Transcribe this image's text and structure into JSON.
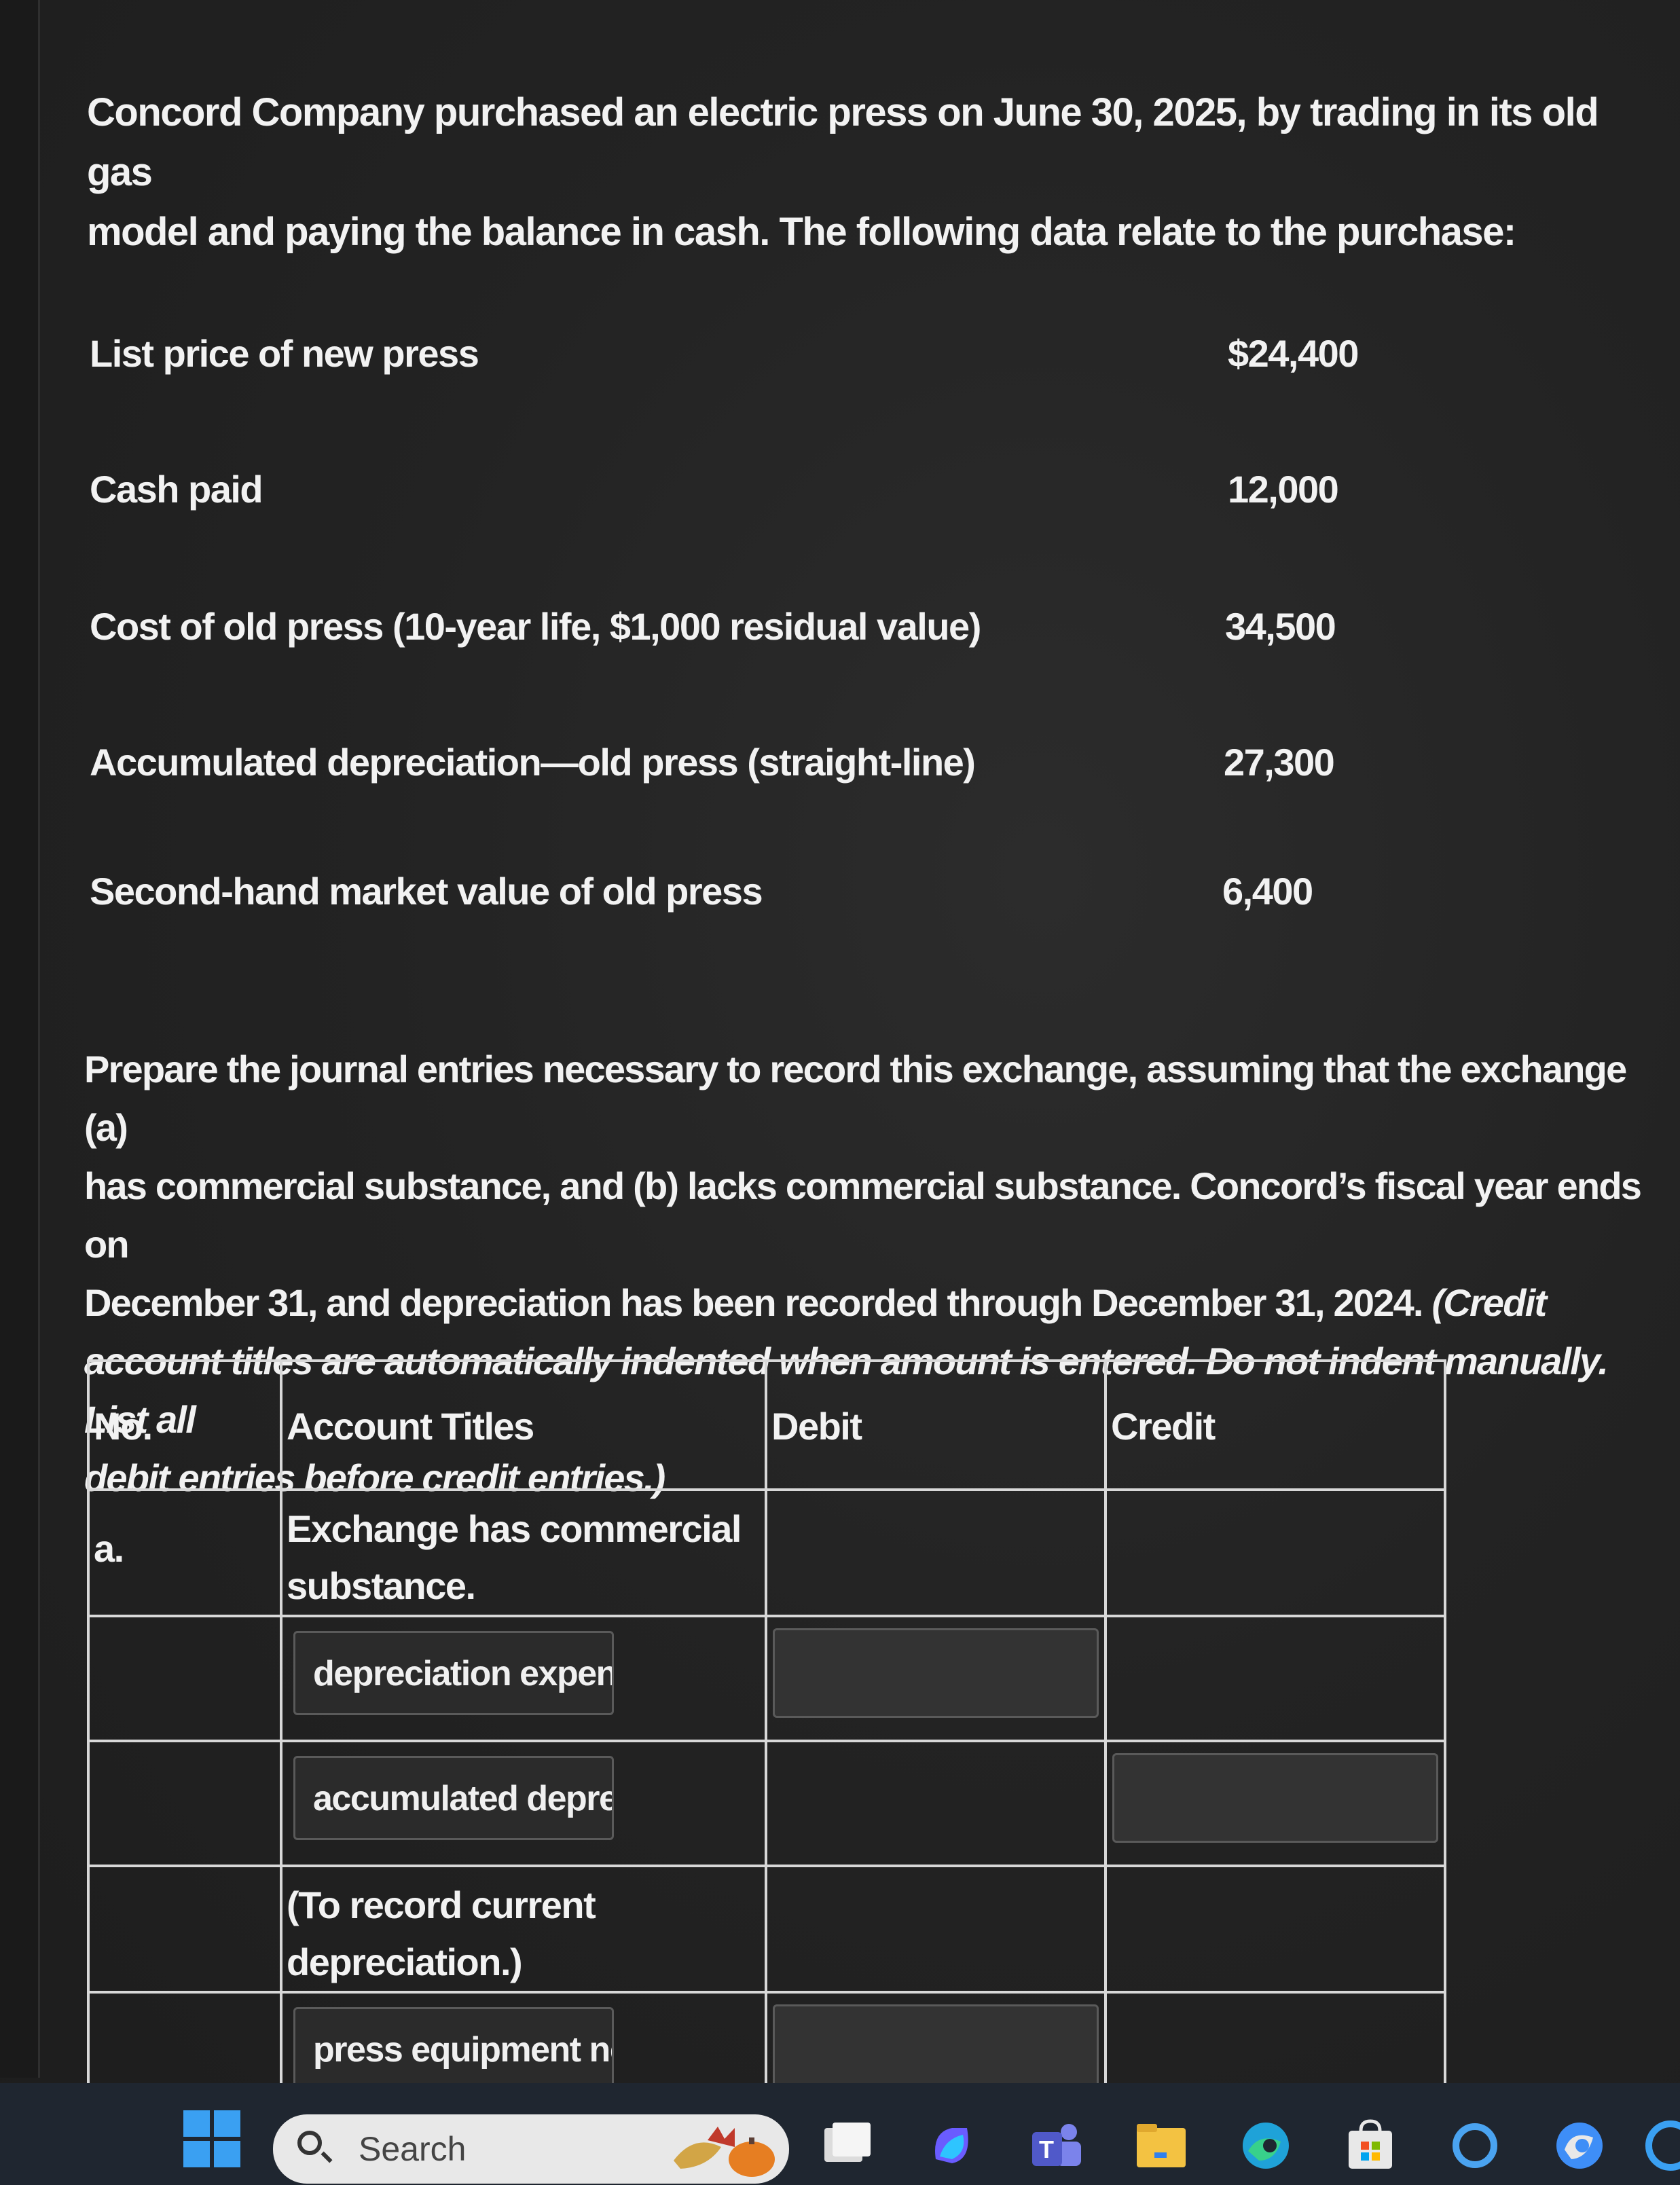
{
  "problem": {
    "intro_line1": "Concord Company purchased an electric press on June 30, 2025, by trading in its old gas",
    "intro_line2": "model and paying the balance in cash. The following data relate to the purchase:",
    "data_rows": [
      {
        "label": "List price of new press",
        "value": "$24,400"
      },
      {
        "label": "Cash paid",
        "value": "12,000"
      },
      {
        "label": "Cost of old press (10-year life, $1,000 residual value)",
        "value": "34,500"
      },
      {
        "label": "Accumulated depreciation—old press (straight-line)",
        "value": "27,300"
      },
      {
        "label": "Second-hand market value of old press",
        "value": "6,400"
      }
    ],
    "instructions_l1": "Prepare the journal entries necessary to record this exchange, assuming that the exchange (a)",
    "instructions_l2": "has commercial substance, and (b) lacks commercial substance. Concord’s fiscal year ends on",
    "instructions_l3a": "December 31, and depreciation has been recorded through December 31, 2024. ",
    "instructions_l3b": "(Credit",
    "instructions_l4": "account titles are automatically indented when amount is entered. Do not indent manually. List all",
    "instructions_l5": "debit entries before credit entries.)"
  },
  "journal": {
    "headers": {
      "no": "No.",
      "account": "Account Titles",
      "debit": "Debit",
      "credit": "Credit"
    },
    "rows": [
      {
        "no": "a.",
        "account_text": "Exchange has commercial substance."
      },
      {
        "account_input": "depreciation expens"
      },
      {
        "account_input": "accumulated deprec"
      },
      {
        "account_text": "(To record current depreciation.)"
      },
      {
        "account_input": "press equipment ne"
      }
    ]
  },
  "taskbar": {
    "search_placeholder": "Search"
  },
  "colors": {
    "background": "#242424",
    "text": "#f2f2f2",
    "table_border": "#d8d8d8",
    "input_bg": "#333333",
    "taskbar": "#1f2630",
    "windows_blue": "#3aa0f2"
  }
}
